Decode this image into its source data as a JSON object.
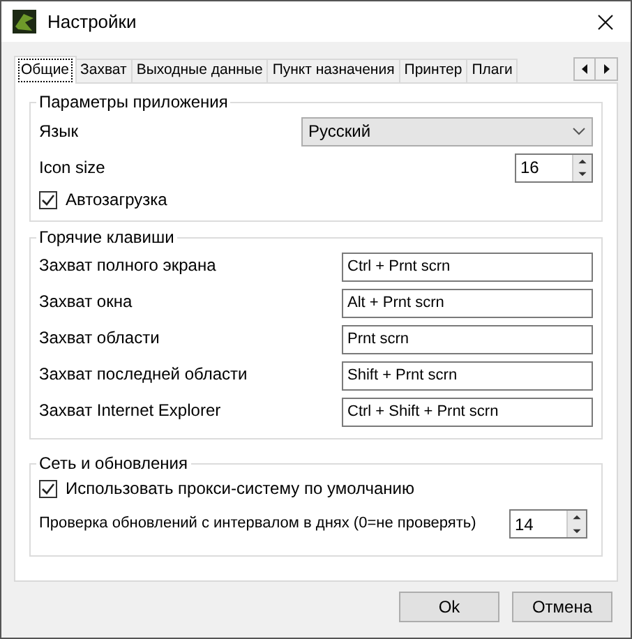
{
  "window": {
    "title": "Настройки"
  },
  "tabs": [
    {
      "label": "Общие",
      "selected": true
    },
    {
      "label": "Захват",
      "selected": false
    },
    {
      "label": "Выходные данные",
      "selected": false
    },
    {
      "label": "Пункт назначения",
      "selected": false
    },
    {
      "label": "Принтер",
      "selected": false
    },
    {
      "label": "Плаги",
      "selected": false
    }
  ],
  "app_settings": {
    "title": "Параметры приложения",
    "language_label": "Язык",
    "language_value": "Русский",
    "icon_size_label": "Icon size",
    "icon_size_value": "16",
    "autostart": {
      "label": "Автозагрузка",
      "checked": true
    }
  },
  "hotkeys": {
    "title": "Горячие клавиши",
    "rows": [
      {
        "label": "Захват полного экрана",
        "value": "Ctrl + Prnt scrn"
      },
      {
        "label": "Захват окна",
        "value": "Alt + Prnt scrn"
      },
      {
        "label": "Захват области",
        "value": "Prnt scrn"
      },
      {
        "label": "Захват последней области",
        "value": "Shift + Prnt scrn"
      },
      {
        "label": "Захват Internet Explorer",
        "value": "Ctrl + Shift + Prnt scrn"
      }
    ]
  },
  "network": {
    "title": "Сеть и обновления",
    "proxy": {
      "label": "Использовать прокси-систему по умолчанию",
      "checked": true
    },
    "interval_label": "Проверка обновлений с интервалом в днях (0=не проверять)",
    "interval_value": "14"
  },
  "buttons": [
    "Ok",
    "Отмена"
  ]
}
